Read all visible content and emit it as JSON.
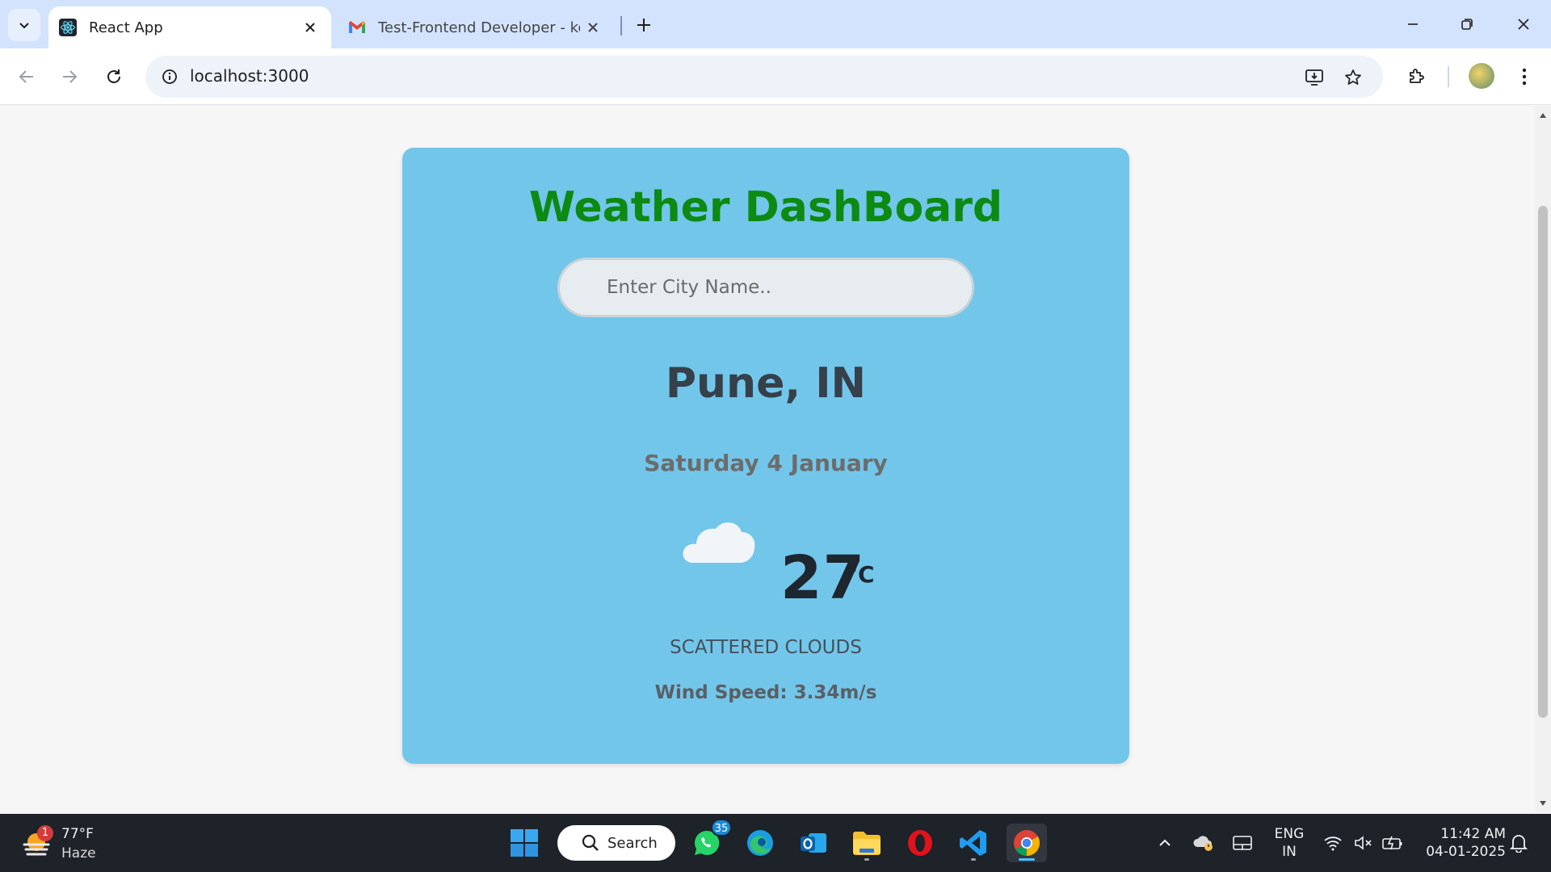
{
  "browser": {
    "tabs": [
      {
        "title": "React App",
        "favicon": "react-icon",
        "active": true
      },
      {
        "title": "Test-Frontend Developer - keng",
        "favicon": "gmail-icon",
        "active": false
      }
    ],
    "url": "localhost:3000"
  },
  "app": {
    "title": "Weather DashBoard",
    "search_placeholder": "Enter City Name..",
    "city": "Pune, IN",
    "date": "Saturday 4 January",
    "weather_icon": "cloud-icon",
    "temperature": "27",
    "unit": "°C",
    "condition": "SCATTERED CLOUDS",
    "wind": "Wind Speed: 3.34m/s",
    "colors": {
      "card": "#72c6ea",
      "title": "#0d8a12"
    }
  },
  "taskbar": {
    "weather": {
      "temp": "77°F",
      "condition": "Haze",
      "badge": "1"
    },
    "search_label": "Search",
    "whatsapp_badge": "35",
    "language": {
      "line1": "ENG",
      "line2": "IN"
    },
    "clock": {
      "time": "11:42 AM",
      "date": "04-01-2025"
    }
  }
}
